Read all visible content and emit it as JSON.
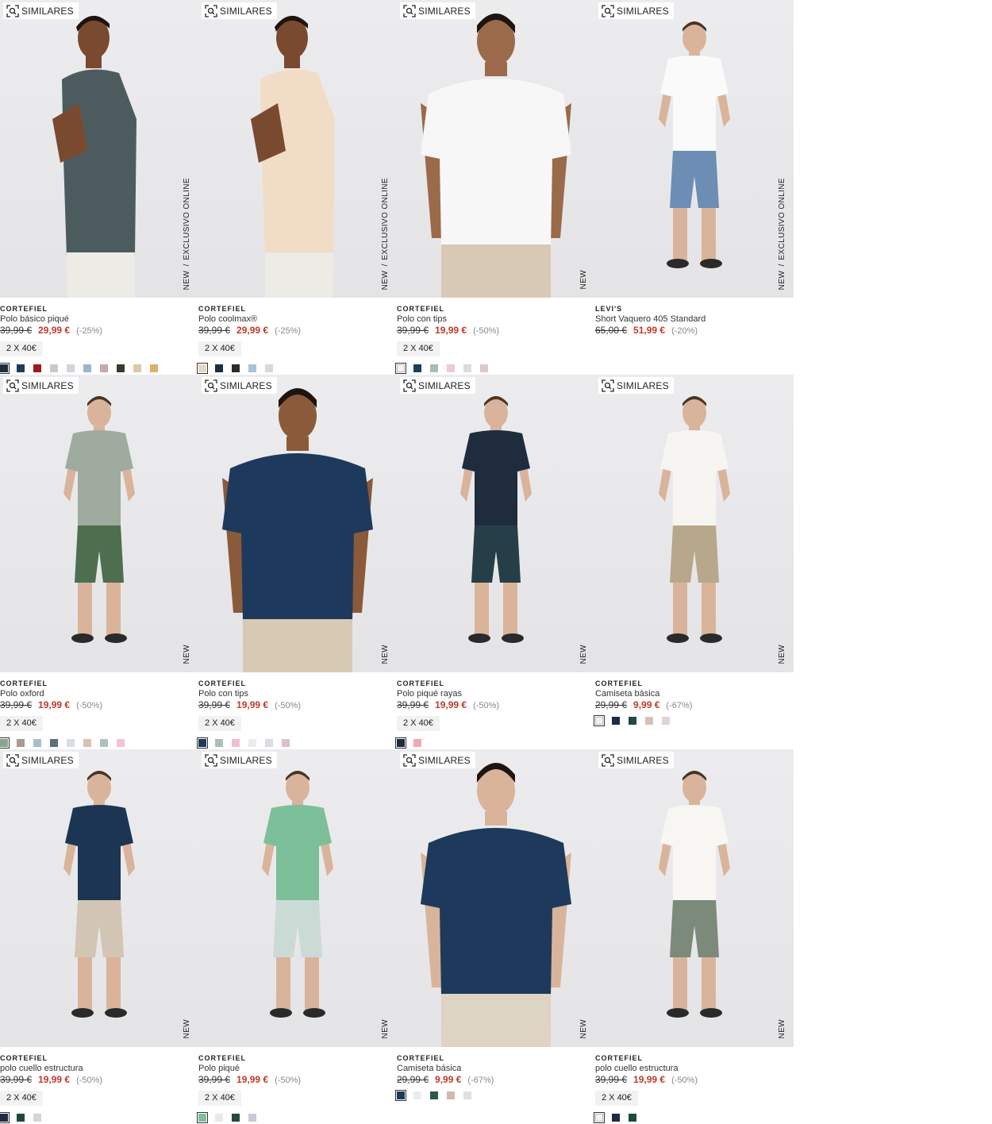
{
  "similar_label": "SIMILARES",
  "tag_new": "NEW",
  "tag_online": "EXCLUSIVO ONLINE",
  "tag_separator": "/",
  "products": [
    {
      "brand": "CORTEFIEL",
      "name": "Polo básico piqué",
      "old": "39,99 €",
      "new": "29,99 €",
      "disc": "(-25%)",
      "promo": "2 X 40€",
      "online": true,
      "top": "#4c5c5e",
      "bottom": "#ecebe6",
      "skin": "#7a4a30",
      "pose": "side",
      "swatches": [
        "#1f2d3a",
        "#1c3e5a",
        "#9b1c1c",
        "#c9c9c9",
        "#cfd6de",
        "#9bb5cc",
        "#c9aaa9",
        "#3a3a2a",
        "#d8c9a8",
        "#e2ac6b"
      ]
    },
    {
      "brand": "CORTEFIEL",
      "name": "Polo coolmax®",
      "old": "39,99 €",
      "new": "29,99 €",
      "disc": "(-25%)",
      "promo": "2 X 40€",
      "online": true,
      "top": "#f1dcc6",
      "bottom": "#ecebe6",
      "skin": "#7a4a30",
      "pose": "side",
      "swatches": [
        "#e6d7c4",
        "#1c2d44",
        "#2a2a2a",
        "#a8c4dc",
        "#d8d8d8"
      ]
    },
    {
      "brand": "CORTEFIEL",
      "name": "Polo con tips",
      "old": "39,99 €",
      "new": "19,99 €",
      "disc": "(-50%)",
      "promo": "2 X 40€",
      "online": false,
      "top": "#f7f7f7",
      "bottom": "#d7c9b6",
      "skin": "#9a6a4a",
      "pose": "front",
      "swatches": [
        "#f3f3f3",
        "#1c3e5a",
        "#a8bdb8",
        "#efc9cf",
        "#d8dde2",
        "#dccaca"
      ]
    },
    {
      "brand": "LEVI'S",
      "name": "Short Vaquero 405 Standard",
      "old": "65,00 €",
      "new": "51,99 €",
      "disc": "(-20%)",
      "promo": "",
      "online": true,
      "top": "#fafafa",
      "bottom": "#6c8eb4",
      "skin": "#d9b49a",
      "pose": "full",
      "swatches": []
    },
    {
      "brand": "CORTEFIEL",
      "name": "Polo oxford",
      "old": "39,99 €",
      "new": "19,99 €",
      "disc": "(-50%)",
      "promo": "2 X 40€",
      "online": false,
      "top": "#9eab9e",
      "bottom": "#4d6e4f",
      "skin": "#d9b49a",
      "pose": "full",
      "swatches": [
        "#8aa590",
        "#a89994",
        "#a8bdd0",
        "#5d6f7e",
        "#d8dde2",
        "#d8c0b2",
        "#a8c4b8",
        "#f2c3cc"
      ]
    },
    {
      "brand": "CORTEFIEL",
      "name": "Polo con tips",
      "old": "39,99 €",
      "new": "19,99 €",
      "disc": "(-50%)",
      "promo": "2 X 40€",
      "online": false,
      "top": "#1d3a5c",
      "bottom": "#d8c9b4",
      "skin": "#8a5a3a",
      "pose": "front",
      "swatches": [
        "#1d3a5c",
        "#a8c0bc",
        "#efc0cc",
        "#ececec",
        "#d8dde2",
        "#dcc0c4"
      ]
    },
    {
      "brand": "CORTEFIEL",
      "name": "Polo piqué rayas",
      "old": "39,99 €",
      "new": "19,99 €",
      "disc": "(-50%)",
      "promo": "2 X 40€",
      "online": false,
      "top": "#1e2c3e",
      "bottom": "#263e48",
      "skin": "#d9b49a",
      "pose": "full",
      "swatches": [
        "#1e2c3e",
        "#f0a8b4"
      ]
    },
    {
      "brand": "CORTEFIEL",
      "name": "Camiseta básica",
      "old": "29,99 €",
      "new": "9,99 €",
      "disc": "(-67%)",
      "promo": "",
      "online": false,
      "top": "#f7f5f2",
      "bottom": "#b7a88c",
      "skin": "#d9b49a",
      "pose": "full",
      "swatches": [
        "#f1f1f1",
        "#1c2d44",
        "#24484a",
        "#d9c0b6",
        "#e4d3d8"
      ]
    },
    {
      "brand": "CORTEFIEL",
      "name": "polo cuello estructura",
      "old": "39,99 €",
      "new": "19,99 €",
      "disc": "(-50%)",
      "promo": "2 X 40€",
      "online": false,
      "top": "#1c3553",
      "bottom": "#d2c5b4",
      "skin": "#d9b49a",
      "pose": "full",
      "swatches": [
        "#1c2d44",
        "#1f4a3a",
        "#d6d6d8"
      ]
    },
    {
      "brand": "CORTEFIEL",
      "name": "Polo piqué",
      "old": "39,99 €",
      "new": "19,99 €",
      "disc": "(-50%)",
      "promo": "2 X 40€",
      "online": false,
      "top": "#7cbf98",
      "bottom": "#cadbd6",
      "skin": "#d9b49a",
      "pose": "full",
      "swatches": [
        "#7cbf98",
        "#e8e8e8",
        "#274a3a",
        "#c7c9d8"
      ]
    },
    {
      "brand": "CORTEFIEL",
      "name": "Camiseta básica",
      "old": "29,99 €",
      "new": "9,99 €",
      "disc": "(-67%)",
      "promo": "",
      "online": false,
      "top": "#1d3a5c",
      "bottom": "#ded4c4",
      "skin": "#d9b49a",
      "pose": "front",
      "swatches": [
        "#1d3a5c",
        "#ececec",
        "#2a5a48",
        "#d4b8ac",
        "#e0e0e0"
      ]
    },
    {
      "brand": "CORTEFIEL",
      "name": "polo cuello estructura",
      "old": "39,99 €",
      "new": "19,99 €",
      "disc": "(-50%)",
      "promo": "2 X 40€",
      "online": false,
      "top": "#f8f6f2",
      "bottom": "#7c8a7c",
      "skin": "#d9b49a",
      "pose": "full",
      "swatches": [
        "#f1f1f1",
        "#1c2d44",
        "#1f4a3a"
      ]
    }
  ]
}
